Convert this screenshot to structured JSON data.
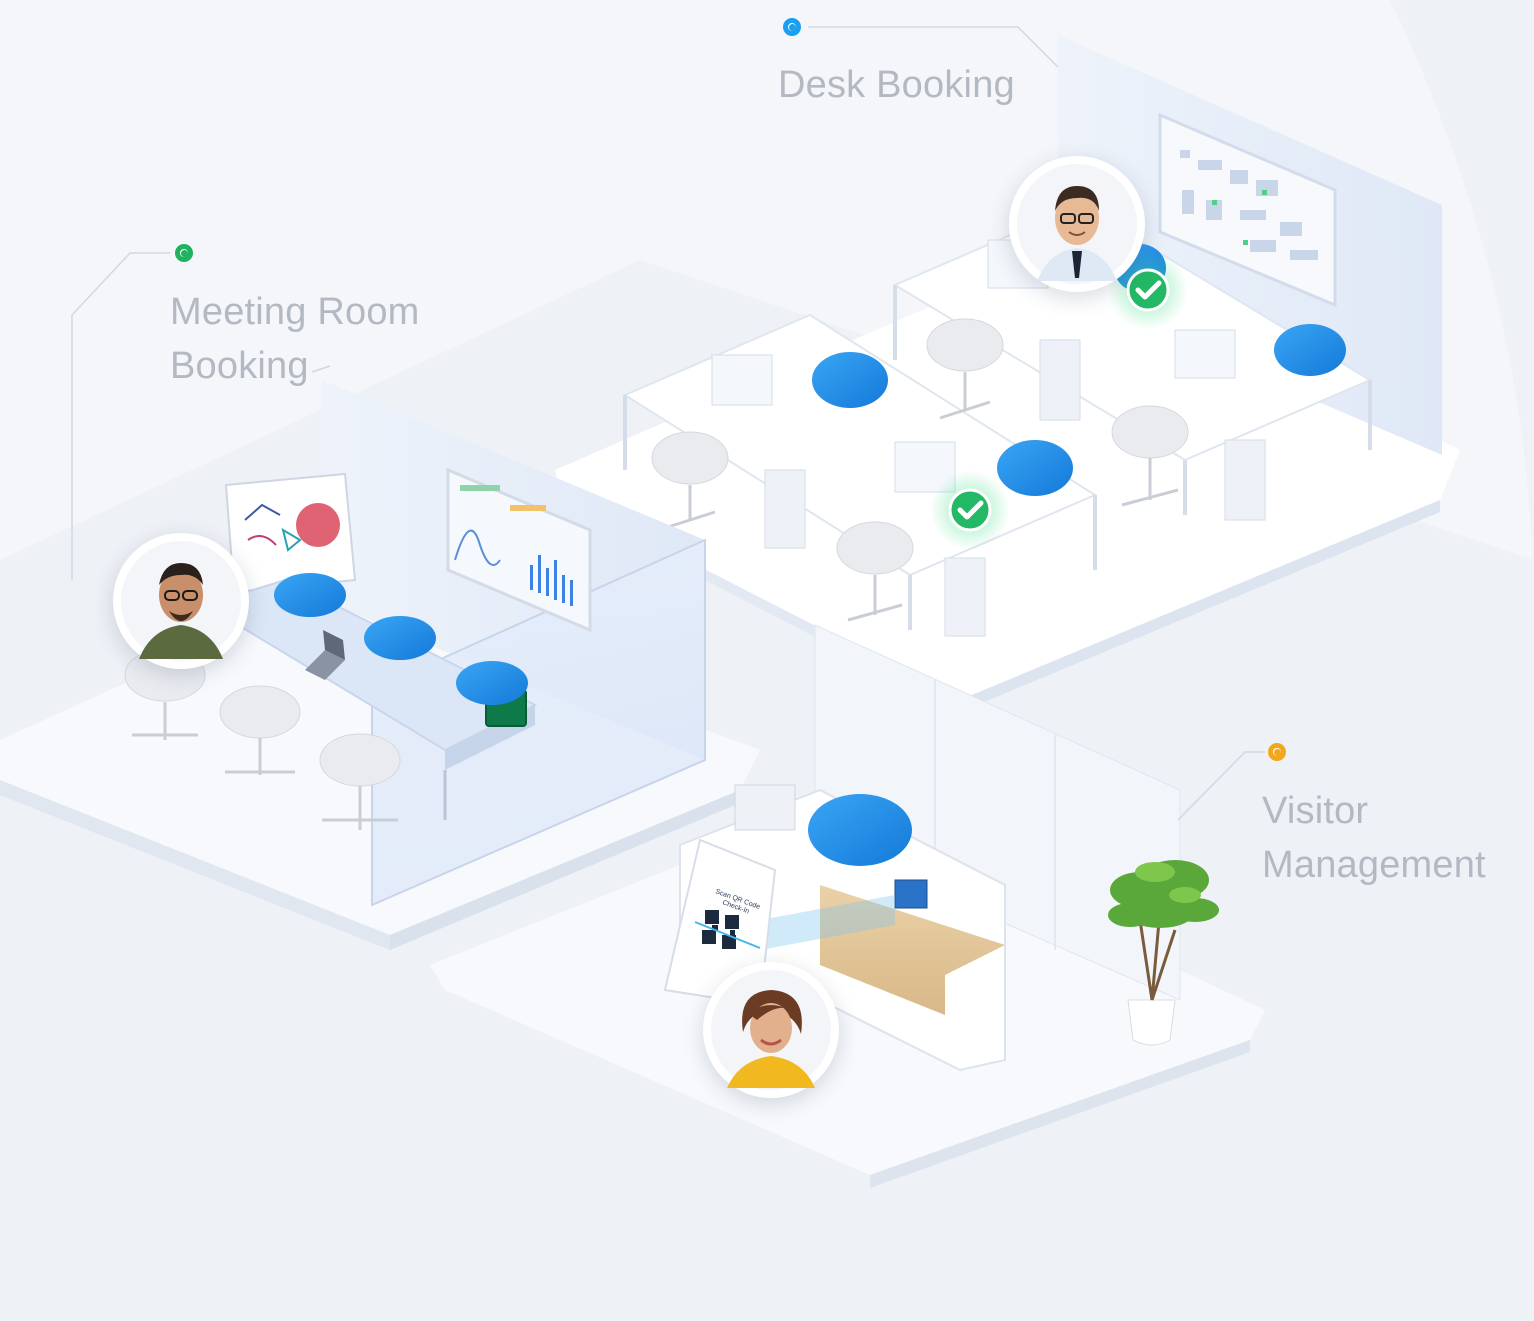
{
  "callouts": {
    "desk": {
      "title": "Desk Booking",
      "color": "#1aa0f0"
    },
    "meeting": {
      "line1": "Meeting Room",
      "line2": "Booking",
      "color": "#1fb35f"
    },
    "visitor": {
      "line1": "Visitor",
      "line2": "Management",
      "color": "#f2a81d"
    }
  },
  "kiosk": {
    "line1": "Scan QR Code",
    "line2": "Check-In"
  },
  "icons": [
    "check-icon",
    "qr-code-icon",
    "laptop-icon",
    "plant-icon"
  ]
}
